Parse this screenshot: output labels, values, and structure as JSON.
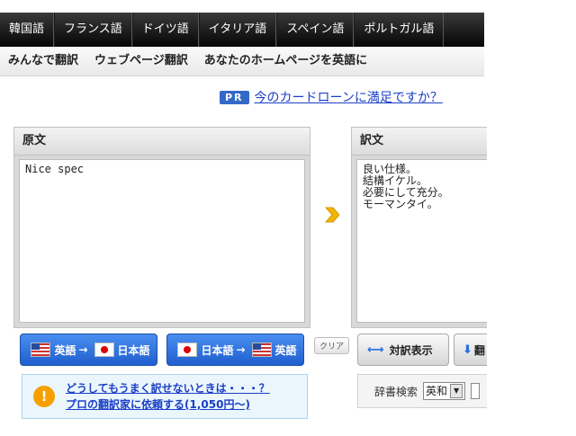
{
  "lang_tabs": [
    "韓国語",
    "フランス語",
    "ドイツ語",
    "イタリア語",
    "スペイン語",
    "ポルトガル語"
  ],
  "subnav": [
    "みんなで翻訳",
    "ウェブページ翻訳",
    "あなたのホームページを英語に"
  ],
  "ad": {
    "badge": "PR",
    "link": "今のカードローンに満足ですか？"
  },
  "source": {
    "title": "原文",
    "text": "Nice  spec"
  },
  "result": {
    "title": "訳文",
    "text": "良い仕様。\n結構イケル。\n必要にして充分。\nモーマンタイ。"
  },
  "buttons": {
    "en_ja": {
      "from": "英語",
      "arrow": "→",
      "to": "日本語"
    },
    "ja_en": {
      "from": "日本語",
      "arrow": "→",
      "to": "英語"
    },
    "clear": "クリア",
    "compare": "対訳表示",
    "download": "翻"
  },
  "notice": {
    "line1": "どうしてもうまく訳せないときは・・・？",
    "line2": "プロの翻訳家に依頼する(1,050円〜)"
  },
  "dict": {
    "label": "辞書検索",
    "selected": "英和"
  },
  "colors": {
    "accent_blue": "#2a6fe0",
    "arrow": "#f0b400",
    "ad_link": "#1a3fc6"
  }
}
